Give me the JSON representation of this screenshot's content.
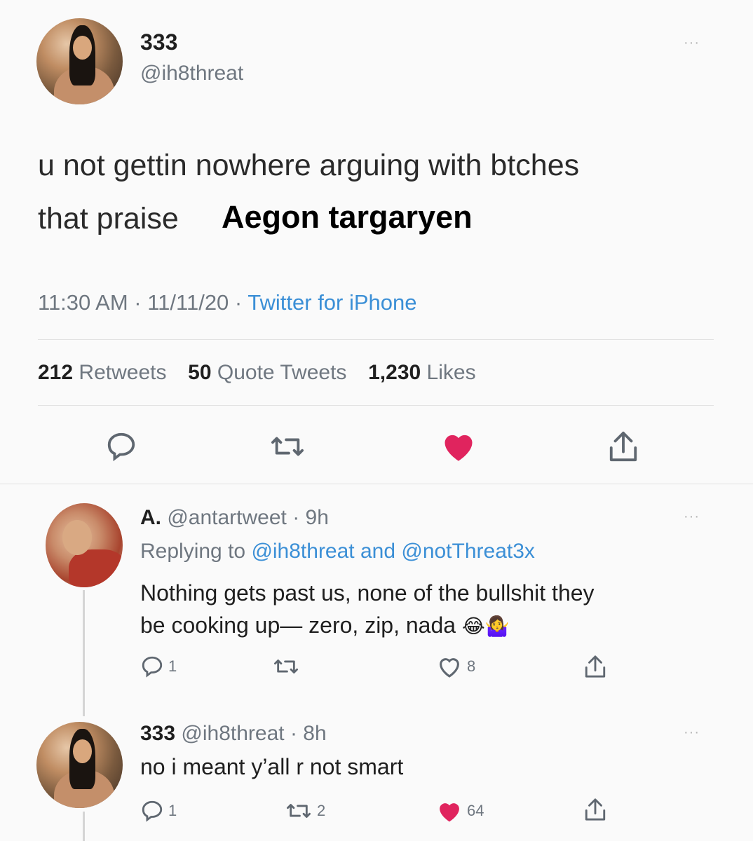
{
  "main_tweet": {
    "display_name": "333",
    "handle": "@ih8threat",
    "text_line1": "u not gettin nowhere arguing with btches",
    "text_line2_prefix": "that praise",
    "text_line2_overlay": "Aegon targaryen",
    "timestamp": "11:30 AM · 11/11/20 · ",
    "source": "Twitter for iPhone",
    "retweets_count": "212",
    "retweets_label": "Retweets",
    "quotes_count": "50",
    "quotes_label": "Quote Tweets",
    "likes_count": "1,230",
    "likes_label": "Likes",
    "icons": [
      "reply-icon",
      "retweet-icon",
      "heart-icon",
      "share-icon"
    ],
    "accent_color": "#e0245e"
  },
  "reply1": {
    "display_name": "A.",
    "handle_time": "@antartweet · 9h",
    "replying_prefix": "Replying to",
    "replying_to": "@ih8threat and @notThreat3x",
    "text_line1": "Nothing gets past us, none of the bullshit they",
    "text_line2": "be cooking up— zero, zip, nada",
    "emoji": "😂🤷‍♀️",
    "reply_count": "1",
    "like_count": "8"
  },
  "reply2": {
    "display_name": "333",
    "handle_time": "@ih8threat · 8h",
    "text_line1": "no i meant y’all r not smart",
    "reply_count": "1",
    "retweet_count": "2",
    "like_count": "64"
  },
  "more_label": "···",
  "link_color": "#3b8fd6"
}
